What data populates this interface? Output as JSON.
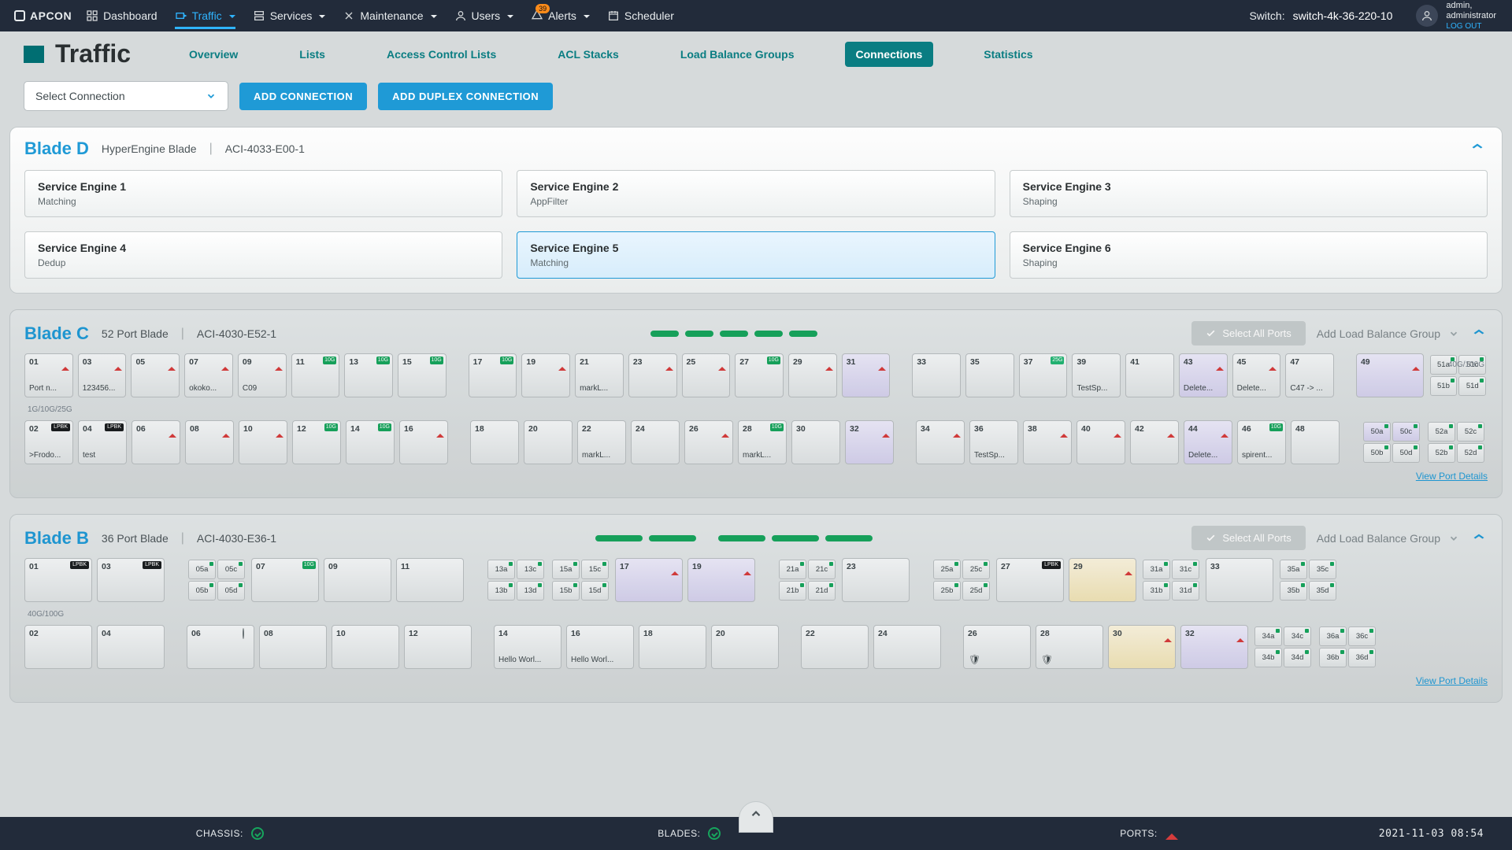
{
  "brand": "APCON",
  "nav": {
    "items": [
      {
        "label": "Dashboard"
      },
      {
        "label": "Traffic",
        "active": true,
        "caret": true
      },
      {
        "label": "Services",
        "caret": true
      },
      {
        "label": "Maintenance",
        "caret": true
      },
      {
        "label": "Users",
        "caret": true
      },
      {
        "label": "Alerts",
        "caret": true,
        "badge": "39"
      },
      {
        "label": "Scheduler"
      }
    ],
    "switch_label": "Switch:",
    "switch_value": "switch-4k-36-220-10",
    "user_name": "admin,",
    "user_role": "administrator",
    "logout": "LOG OUT"
  },
  "page_title": "Traffic",
  "tabs": [
    "Overview",
    "Lists",
    "Access Control Lists",
    "ACL Stacks",
    "Load Balance Groups",
    "Connections",
    "Statistics"
  ],
  "active_tab": "Connections",
  "select_conn_placeholder": "Select Connection",
  "btn_add_conn": "ADD CONNECTION",
  "btn_add_duplex": "ADD DUPLEX CONNECTION",
  "select_all_ports": "Select All Ports",
  "add_lbg": "Add Load Balance Group",
  "view_port_details": "View Port Details",
  "bladeD": {
    "name": "Blade D",
    "type": "HyperEngine Blade",
    "id": "ACI-4033-E00-1",
    "engines": [
      {
        "t": "Service Engine 1",
        "s": "Matching"
      },
      {
        "t": "Service Engine 2",
        "s": "AppFilter"
      },
      {
        "t": "Service Engine 3",
        "s": "Shaping"
      },
      {
        "t": "Service Engine 4",
        "s": "Dedup"
      },
      {
        "t": "Service Engine 5",
        "s": "Matching",
        "sel": true
      },
      {
        "t": "Service Engine 6",
        "s": "Shaping"
      }
    ]
  },
  "bladeC": {
    "name": "Blade C",
    "type": "52 Port Blade",
    "id": "ACI-4030-E52-1",
    "rate1": "1G/10G/25G",
    "rate2": "40G/100G",
    "row1": [
      {
        "n": "01",
        "ind": "tri",
        "lbl": "Port n..."
      },
      {
        "n": "03",
        "ind": "tri",
        "lbl": "123456..."
      },
      {
        "n": "05",
        "ind": "tri"
      },
      {
        "n": "07",
        "ind": "tri",
        "lbl": "okoko..."
      },
      {
        "n": "09",
        "ind": "tri",
        "lbl": "C09"
      },
      {
        "n": "11",
        "tag": "10G"
      },
      {
        "n": "13",
        "tag": "10G"
      },
      {
        "n": "15",
        "tag": "10G"
      },
      {
        "gap": true
      },
      {
        "n": "17",
        "tag": "10G"
      },
      {
        "n": "19",
        "ind": "tri"
      },
      {
        "n": "21",
        "ind": "dot",
        "lbl": "markL..."
      },
      {
        "n": "23",
        "ind": "tri"
      },
      {
        "n": "25",
        "ind": "tri"
      },
      {
        "n": "27",
        "tag": "10G"
      },
      {
        "n": "29",
        "ind": "tri"
      },
      {
        "n": "31",
        "ind": "tri",
        "cls": "purple"
      },
      {
        "gap": true
      },
      {
        "n": "33",
        "ind": "dot"
      },
      {
        "n": "35",
        "ind": "dot"
      },
      {
        "n": "37",
        "tag": "25G"
      },
      {
        "n": "39",
        "ind": "dot",
        "lbl": "TestSp..."
      },
      {
        "n": "41",
        "ind": "dot"
      },
      {
        "n": "43",
        "ind": "tri",
        "lbl": "Delete...",
        "cls": "purple"
      },
      {
        "n": "45",
        "ind": "tri",
        "lbl": "Delete..."
      },
      {
        "n": "47",
        "ind": "dot",
        "lbl": "C47 -> ..."
      },
      {
        "gap": true
      },
      {
        "n": "49",
        "ind": "tri",
        "cls": "purple",
        "big": true
      },
      {
        "quad": [
          "51a",
          "51c",
          "51b",
          "51d"
        ]
      }
    ],
    "row2": [
      {
        "n": "02",
        "tag": "LPBK",
        "lbl": ">Frodo..."
      },
      {
        "n": "04",
        "tag": "LPBK",
        "lbl": "test"
      },
      {
        "n": "06",
        "ind": "tri"
      },
      {
        "n": "08",
        "ind": "tri"
      },
      {
        "n": "10",
        "ind": "tri"
      },
      {
        "n": "12",
        "tag": "10G"
      },
      {
        "n": "14",
        "tag": "10G"
      },
      {
        "n": "16",
        "ind": "tri"
      },
      {
        "gap": true
      },
      {
        "n": "18",
        "ind": "dot"
      },
      {
        "n": "20",
        "ind": "dot"
      },
      {
        "n": "22",
        "ind": "dot",
        "lbl": "markL..."
      },
      {
        "n": "24",
        "ind": "dot"
      },
      {
        "n": "26",
        "ind": "tri"
      },
      {
        "n": "28",
        "tag": "10G",
        "lbl": "markL..."
      },
      {
        "n": "30",
        "ind": "dot"
      },
      {
        "n": "32",
        "ind": "tri",
        "cls": "purple"
      },
      {
        "gap": true
      },
      {
        "n": "34",
        "ind": "tri"
      },
      {
        "n": "36",
        "ind": "dot",
        "lbl": "TestSp..."
      },
      {
        "n": "38",
        "ind": "tri"
      },
      {
        "n": "40",
        "ind": "tri"
      },
      {
        "n": "42",
        "ind": "tri"
      },
      {
        "n": "44",
        "ind": "tri",
        "lbl": "Delete...",
        "cls": "purple"
      },
      {
        "n": "46",
        "tag": "10G",
        "lbl": "spirent..."
      },
      {
        "n": "48",
        "ind": "dot"
      },
      {
        "gap": true
      },
      {
        "quad": [
          "50a",
          "50c",
          "50b",
          "50d"
        ],
        "purple": [
          0,
          1
        ]
      },
      {
        "quad": [
          "52a",
          "52c",
          "52b",
          "52d"
        ]
      }
    ]
  },
  "bladeB": {
    "name": "Blade B",
    "type": "36 Port Blade",
    "id": "ACI-4030-E36-1",
    "rate": "40G/100G",
    "row1": [
      {
        "n": "01",
        "tag": "LPBK",
        "big": true
      },
      {
        "n": "03",
        "tag": "LPBK",
        "big": true
      },
      {
        "gap": true
      },
      {
        "quad": [
          "05a",
          "05c",
          "05b",
          "05d"
        ]
      },
      {
        "n": "07",
        "tag": "10G",
        "big": true
      },
      {
        "n": "09",
        "ind": "dot",
        "big": true
      },
      {
        "n": "11",
        "ind": "dot",
        "big": true
      },
      {
        "gap": true
      },
      {
        "quad": [
          "13a",
          "13c",
          "13b",
          "13d"
        ]
      },
      {
        "quad": [
          "15a",
          "15c",
          "15b",
          "15d"
        ]
      },
      {
        "n": "17",
        "ind": "tri",
        "big": true,
        "cls": "purple"
      },
      {
        "n": "19",
        "ind": "tri",
        "big": true,
        "cls": "purple"
      },
      {
        "gap": true
      },
      {
        "quad": [
          "21a",
          "21c",
          "21b",
          "21d"
        ]
      },
      {
        "n": "23",
        "ind": "dot",
        "big": true
      },
      {
        "gap": true
      },
      {
        "quad": [
          "25a",
          "25c",
          "25b",
          "25d"
        ]
      },
      {
        "n": "27",
        "tag": "LPBK",
        "big": true
      },
      {
        "n": "29",
        "ind": "tri",
        "big": true,
        "cls": "yellow"
      },
      {
        "quad": [
          "31a",
          "31c",
          "31b",
          "31d"
        ]
      },
      {
        "n": "33",
        "ind": "dot",
        "big": true
      },
      {
        "quad": [
          "35a",
          "35c",
          "35b",
          "35d"
        ]
      }
    ],
    "row2": [
      {
        "n": "02",
        "ind": "dot",
        "big": true
      },
      {
        "n": "04",
        "ind": "dot",
        "big": true
      },
      {
        "gap": true
      },
      {
        "n": "06",
        "ind": "hol",
        "big": true
      },
      {
        "n": "08",
        "ind": "dot",
        "big": true
      },
      {
        "n": "10",
        "ind": "dot",
        "big": true
      },
      {
        "n": "12",
        "ind": "dot",
        "big": true
      },
      {
        "gap": true
      },
      {
        "n": "14",
        "ind": "dot",
        "big": true,
        "lbl": "Hello Worl..."
      },
      {
        "n": "16",
        "ind": "dot",
        "big": true,
        "lbl": "Hello Worl..."
      },
      {
        "n": "18",
        "ind": "dot",
        "big": true
      },
      {
        "n": "20",
        "ind": "dot",
        "big": true
      },
      {
        "gap": true
      },
      {
        "n": "22",
        "ind": "dot",
        "big": true
      },
      {
        "n": "24",
        "ind": "dot",
        "big": true
      },
      {
        "gap": true
      },
      {
        "n": "26",
        "ind": "dot",
        "big": true,
        "shield": true
      },
      {
        "n": "28",
        "ind": "dot",
        "big": true,
        "shield": true
      },
      {
        "n": "30",
        "ind": "tri",
        "big": true,
        "cls": "yellow"
      },
      {
        "n": "32",
        "ind": "tri",
        "big": true,
        "cls": "purple"
      },
      {
        "quad": [
          "34a",
          "34c",
          "34b",
          "34d"
        ]
      },
      {
        "quad": [
          "36a",
          "36c",
          "36b",
          "36d"
        ]
      }
    ]
  },
  "footer": {
    "chassis": "CHASSIS:",
    "blades": "BLADES:",
    "ports": "PORTS:",
    "timestamp": "2021-11-03 08:54"
  }
}
